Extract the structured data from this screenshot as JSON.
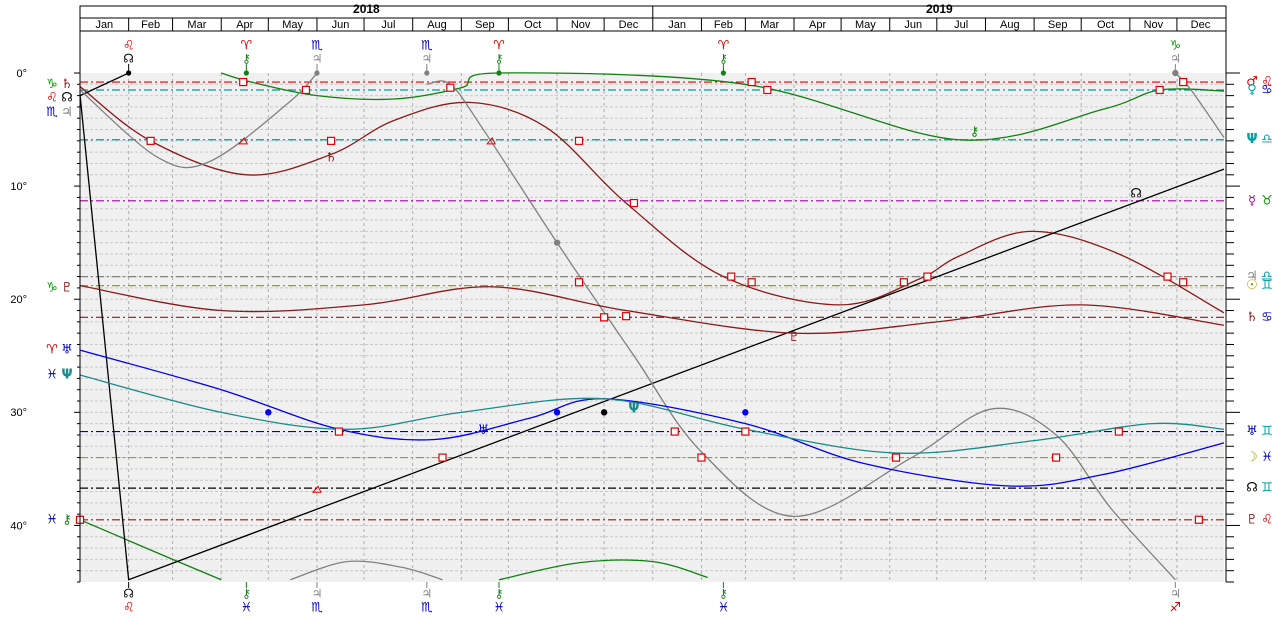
{
  "chart_data": {
    "type": "line",
    "years": [
      "2018",
      "2019"
    ],
    "months": [
      "Jan",
      "Feb",
      "Mar",
      "Apr",
      "May",
      "Jun",
      "Jul",
      "Aug",
      "Sep",
      "Oct",
      "Nov",
      "Dec"
    ],
    "x_domain": [
      "2018-01-01",
      "2019-12-31"
    ],
    "ylim": [
      0,
      45
    ],
    "y_ticks": [
      0,
      10,
      20,
      30,
      40
    ],
    "y_tick_suffix": "°",
    "grid": true,
    "colors": {
      "saturn": "#8b1a1a",
      "chiron": "#108010",
      "node": "#000000",
      "mercury": "#808080",
      "mars": "#e00000",
      "uranus": "#0000ee",
      "neptune": "#1a8a8a",
      "pluto": "#8b1a1a",
      "ref_red": "#e00000",
      "ref_cyan": "#00a0a0",
      "ref_purple": "#a000a0",
      "ref_olive": "#a0a000",
      "ref_brown": "#8b1a1a",
      "ref_blue": "#0000c0",
      "ref_black": "#000000",
      "sign_red": "#e00000",
      "sign_blue": "#0000c0",
      "sign_green": "#00a000"
    },
    "series": [
      {
        "key": "saturn",
        "color": "#8b1a1a",
        "x": [
          "2018-01-01",
          "2018-02-15",
          "2018-04-17",
          "2018-06-10",
          "2018-07-20",
          "2018-09-06",
          "2018-10-25",
          "2018-12-15",
          "2019-02-15",
          "2019-04-30",
          "2019-06-20",
          "2019-07-15",
          "2019-08-30",
          "2019-10-25",
          "2019-12-31"
        ],
        "y": [
          1.2,
          6.0,
          9.0,
          7.2,
          4.2,
          2.6,
          4.8,
          11.5,
          18.0,
          20.5,
          18.2,
          16.2,
          14.0,
          16.0,
          21.2
        ]
      },
      {
        "key": "chiron",
        "color": "#108010",
        "x": [
          "2018-04-01",
          "2018-04-20",
          "2018-06-01",
          "2018-07-20",
          "2018-09-01",
          "2018-09-25",
          "2019-03-01",
          "2019-07-15",
          "2019-10-15",
          "2019-11-20",
          "2019-12-31"
        ],
        "y": [
          0.0,
          0.8,
          2.0,
          2.3,
          1.3,
          0.0,
          1.0,
          5.9,
          3.2,
          1.5,
          1.6
        ]
      },
      {
        "key": "chiron_b",
        "color": "#108010",
        "x": [
          "2018-01-01",
          "2018-03-01",
          "2018-04-01"
        ],
        "y": [
          39.5,
          43.0,
          44.8
        ]
      },
      {
        "key": "chiron_c",
        "color": "#108010",
        "x": [
          "2018-09-25",
          "2018-11-15",
          "2019-01-01",
          "2019-02-05"
        ],
        "y": [
          44.8,
          43.3,
          43.2,
          44.6
        ]
      },
      {
        "key": "node",
        "color": "#000000",
        "x": [
          "2018-01-01",
          "2018-02-01",
          "2019-12-31"
        ],
        "y": [
          1.9,
          44.8,
          8.5
        ]
      },
      {
        "key": "node_b",
        "color": "#000000",
        "x": [
          "2018-01-01",
          "2018-02-01"
        ],
        "y": [
          2.0,
          0.0
        ]
      },
      {
        "key": "mercury",
        "color": "#808080",
        "x": [
          "2018-01-01",
          "2018-02-20",
          "2018-03-25",
          "2018-05-15",
          "2018-06-01"
        ],
        "y": [
          1.5,
          7.5,
          7.8,
          2.5,
          0.0
        ]
      },
      {
        "key": "mercury_b",
        "color": "#808080",
        "x": [
          "2018-08-10",
          "2018-08-25",
          "2018-09-15",
          "2018-11-01",
          "2018-12-20",
          "2019-02-01",
          "2019-04-01",
          "2019-06-15",
          "2019-08-05",
          "2019-09-15",
          "2019-10-20",
          "2019-11-30"
        ],
        "y": [
          1.0,
          1.0,
          5.0,
          15.0,
          25.0,
          33.5,
          39.2,
          34.0,
          29.7,
          32.0,
          38.5,
          44.8
        ]
      },
      {
        "key": "mercury_c",
        "color": "#808080",
        "x": [
          "2018-05-15",
          "2018-06-20",
          "2018-07-25",
          "2018-08-20"
        ],
        "y": [
          44.8,
          43.2,
          43.7,
          44.8
        ]
      },
      {
        "key": "mercury_d",
        "color": "#808080",
        "x": [
          "2019-11-30",
          "2019-12-10",
          "2019-12-31"
        ],
        "y": [
          0.0,
          1.5,
          5.7
        ]
      },
      {
        "key": "uranus",
        "color": "#0000ee",
        "x": [
          "2018-01-01",
          "2018-04-01",
          "2018-06-15",
          "2018-08-15",
          "2018-10-15",
          "2018-12-01",
          "2019-03-01",
          "2019-05-15",
          "2019-08-15",
          "2019-10-15",
          "2019-12-31"
        ],
        "y": [
          24.5,
          28.0,
          31.5,
          32.4,
          30.5,
          28.8,
          31.0,
          34.5,
          36.5,
          35.5,
          32.7
        ]
      },
      {
        "key": "neptune",
        "color": "#1a8a8a",
        "x": [
          "2018-01-01",
          "2018-04-01",
          "2018-06-20",
          "2018-09-01",
          "2018-12-01",
          "2019-03-01",
          "2019-06-05",
          "2019-09-01",
          "2019-11-15",
          "2019-12-31"
        ],
        "y": [
          26.7,
          30.0,
          31.5,
          30.0,
          28.8,
          31.5,
          33.6,
          32.5,
          31.0,
          31.5
        ]
      },
      {
        "key": "pluto",
        "color": "#8b1a1a",
        "x": [
          "2018-01-01",
          "2018-04-01",
          "2018-07-01",
          "2018-09-20",
          "2018-12-15",
          "2019-04-01",
          "2019-07-01",
          "2019-10-01",
          "2019-12-31"
        ],
        "y": [
          18.8,
          21.0,
          20.5,
          18.9,
          21.0,
          23.0,
          22.0,
          20.5,
          22.3
        ]
      }
    ],
    "markers": [
      {
        "series": "saturn",
        "x": "2018-02-15",
        "y": 6.0,
        "shape": "square",
        "color": "#e00000"
      },
      {
        "series": "saturn",
        "x": "2018-04-15",
        "y": 6.0,
        "shape": "triangle",
        "color": "#e00000"
      },
      {
        "series": "saturn",
        "x": "2018-06-10",
        "y": 6.0,
        "shape": "square",
        "color": "#e00000"
      },
      {
        "series": "saturn",
        "x": "2018-09-20",
        "y": 6.0,
        "shape": "triangle",
        "color": "#e00000"
      },
      {
        "series": "saturn",
        "x": "2018-11-15",
        "y": 6.0,
        "shape": "square",
        "color": "#e00000"
      },
      {
        "series": "saturn",
        "x": "2018-12-20",
        "y": 11.5,
        "shape": "square",
        "color": "#e00000"
      },
      {
        "series": "saturn",
        "x": "2019-02-20",
        "y": 18.0,
        "shape": "square",
        "color": "#e00000"
      },
      {
        "series": "saturn",
        "x": "2019-03-05",
        "y": 18.5,
        "shape": "square",
        "color": "#e00000"
      },
      {
        "series": "saturn",
        "x": "2019-06-10",
        "y": 18.5,
        "shape": "square",
        "color": "#e00000"
      },
      {
        "series": "saturn",
        "x": "2019-06-25",
        "y": 18.0,
        "shape": "square",
        "color": "#e00000"
      },
      {
        "series": "saturn",
        "x": "2019-11-25",
        "y": 18.0,
        "shape": "square",
        "color": "#e00000"
      },
      {
        "series": "saturn",
        "x": "2019-12-05",
        "y": 18.5,
        "shape": "square",
        "color": "#e00000"
      },
      {
        "series": "chiron",
        "x": "2018-04-15",
        "y": 0.8,
        "shape": "square",
        "color": "#e00000"
      },
      {
        "series": "chiron",
        "x": "2018-05-25",
        "y": 1.5,
        "shape": "square",
        "color": "#e00000"
      },
      {
        "series": "chiron",
        "x": "2018-08-25",
        "y": 1.3,
        "shape": "square",
        "color": "#e00000"
      },
      {
        "series": "chiron",
        "x": "2019-03-05",
        "y": 0.8,
        "shape": "square",
        "color": "#e00000"
      },
      {
        "series": "chiron",
        "x": "2019-03-15",
        "y": 1.5,
        "shape": "square",
        "color": "#e00000"
      },
      {
        "series": "chiron",
        "x": "2019-11-20",
        "y": 1.5,
        "shape": "square",
        "color": "#e00000"
      },
      {
        "series": "chiron",
        "x": "2019-12-05",
        "y": 0.8,
        "shape": "square",
        "color": "#e00000"
      },
      {
        "series": "node",
        "x": "2018-12-01",
        "y": 30.0,
        "shape": "dot",
        "color": "#000000"
      },
      {
        "series": "node",
        "x": "2018-08-20",
        "y": 34.0,
        "shape": "square",
        "color": "#e00000"
      },
      {
        "series": "node",
        "x": "2018-06-01",
        "y": 36.8,
        "shape": "triangle",
        "color": "#e00000"
      },
      {
        "series": "node",
        "x": "2018-01-01",
        "y": 39.5,
        "shape": "square",
        "color": "#e00000"
      },
      {
        "series": "mercury",
        "x": "2018-11-01",
        "y": 15.0,
        "shape": "dot",
        "color": "#808080"
      },
      {
        "series": "mercury",
        "x": "2018-11-15",
        "y": 18.5,
        "shape": "square",
        "color": "#e00000"
      },
      {
        "series": "mercury",
        "x": "2018-12-15",
        "y": 21.5,
        "shape": "square",
        "color": "#e00000"
      },
      {
        "series": "mercury",
        "x": "2019-01-15",
        "y": 31.7,
        "shape": "square",
        "color": "#e00000"
      },
      {
        "series": "mercury",
        "x": "2019-02-01",
        "y": 34.0,
        "shape": "square",
        "color": "#e00000"
      },
      {
        "series": "mercury",
        "x": "2019-11-30",
        "y": 0.0,
        "shape": "dot",
        "color": "#808080"
      },
      {
        "series": "uranus",
        "x": "2018-05-01",
        "y": 30.0,
        "shape": "dot",
        "color": "#0000ee"
      },
      {
        "series": "uranus",
        "x": "2018-11-01",
        "y": 30.0,
        "shape": "dot",
        "color": "#0000ee"
      },
      {
        "series": "uranus",
        "x": "2019-03-01",
        "y": 30.0,
        "shape": "dot",
        "color": "#0000ee"
      },
      {
        "series": "neptune",
        "x": "2018-06-15",
        "y": 31.7,
        "shape": "square",
        "color": "#e00000"
      },
      {
        "series": "neptune",
        "x": "2019-03-01",
        "y": 31.7,
        "shape": "square",
        "color": "#e00000"
      },
      {
        "series": "neptune",
        "x": "2019-06-05",
        "y": 34.0,
        "shape": "square",
        "color": "#e00000"
      },
      {
        "series": "neptune",
        "x": "2019-09-15",
        "y": 34.0,
        "shape": "square",
        "color": "#e00000"
      },
      {
        "series": "neptune",
        "x": "2019-10-25",
        "y": 31.7,
        "shape": "square",
        "color": "#e00000"
      },
      {
        "series": "pluto",
        "x": "2018-12-01",
        "y": 21.6,
        "shape": "square",
        "color": "#e00000"
      },
      {
        "series": "pluto",
        "x": "2019-12-15",
        "y": 39.5,
        "shape": "square",
        "color": "#e00000"
      }
    ],
    "ref_lines": [
      {
        "y": 0.8,
        "color": "#e00000",
        "glyphs": [
          {
            "t": "♂",
            "c": "#e00000"
          },
          {
            "t": "♌",
            "c": "#e00000"
          }
        ]
      },
      {
        "y": 1.5,
        "color": "#00a0a0",
        "glyphs": [
          {
            "t": "♀",
            "c": "#00a0a0"
          },
          {
            "t": "♋",
            "c": "#0000c0"
          }
        ]
      },
      {
        "y": 5.9,
        "color": "#00a0a0",
        "glyphs": [
          {
            "t": "Ψ",
            "c": "#00a0a0"
          },
          {
            "t": "♎",
            "c": "#00a0a0"
          }
        ]
      },
      {
        "y": 11.3,
        "color": "#a000a0",
        "glyphs": [
          {
            "t": "☿",
            "c": "#a000a0"
          },
          {
            "t": "♉",
            "c": "#00a000"
          }
        ]
      },
      {
        "y": 18.0,
        "color": "#808080",
        "glyphs": [
          {
            "t": "♃",
            "c": "#808080"
          },
          {
            "t": "♎",
            "c": "#00a0a0"
          }
        ]
      },
      {
        "y": 18.8,
        "color": "#a0a000",
        "glyphs": [
          {
            "t": "☉",
            "c": "#a0a000"
          },
          {
            "t": "♊",
            "c": "#00a0a0"
          }
        ]
      },
      {
        "y": 21.6,
        "color": "#8b1a1a",
        "glyphs": [
          {
            "t": "♄",
            "c": "#8b1a1a"
          },
          {
            "t": "♋",
            "c": "#0000c0"
          }
        ]
      },
      {
        "y": 31.7,
        "color": "#0000c0",
        "glyphs": [
          {
            "t": "♅",
            "c": "#0000c0"
          },
          {
            "t": "♊",
            "c": "#00a0a0"
          }
        ]
      },
      {
        "y": 34.0,
        "color": "#a0a000",
        "glyphs": [
          {
            "t": "☽",
            "c": "#a0a000"
          },
          {
            "t": "♓",
            "c": "#0000c0"
          }
        ]
      },
      {
        "y": 36.7,
        "color": "#000000",
        "glyphs": [
          {
            "t": "☊",
            "c": "#000000"
          },
          {
            "t": "♊",
            "c": "#00a0a0"
          }
        ]
      },
      {
        "y": 39.5,
        "color": "#8b1a1a",
        "glyphs": [
          {
            "t": "♇",
            "c": "#8b1a1a"
          },
          {
            "t": "♌",
            "c": "#e00000"
          }
        ]
      }
    ],
    "left_labels": [
      {
        "y": 1.0,
        "glyphs": [
          {
            "t": "♑",
            "c": "#00a000"
          },
          {
            "t": "♄",
            "c": "#8b1a1a"
          }
        ]
      },
      {
        "y": 2.2,
        "glyphs": [
          {
            "t": "♌",
            "c": "#e00000"
          },
          {
            "t": "☊",
            "c": "#000000"
          }
        ]
      },
      {
        "y": 3.5,
        "glyphs": [
          {
            "t": "♏",
            "c": "#0000c0"
          },
          {
            "t": "♃",
            "c": "#808080"
          }
        ]
      },
      {
        "y": 19.0,
        "glyphs": [
          {
            "t": "♑",
            "c": "#00a000"
          },
          {
            "t": "♇",
            "c": "#8b1a1a"
          }
        ]
      },
      {
        "y": 24.5,
        "glyphs": [
          {
            "t": "♈",
            "c": "#e00000"
          },
          {
            "t": "♅",
            "c": "#0000c0"
          }
        ]
      },
      {
        "y": 26.7,
        "glyphs": [
          {
            "t": "♓",
            "c": "#0000c0"
          },
          {
            "t": "Ψ",
            "c": "#1a8a8a"
          }
        ]
      },
      {
        "y": 39.5,
        "glyphs": [
          {
            "t": "♓",
            "c": "#0000c0"
          },
          {
            "t": "⚷",
            "c": "#108010"
          }
        ]
      }
    ],
    "top_events": [
      {
        "x": "2018-02-01",
        "sign": "♌",
        "sign_c": "#e00000",
        "planet": "☊",
        "planet_c": "#000000"
      },
      {
        "x": "2018-04-17",
        "sign": "♈",
        "sign_c": "#e00000",
        "planet": "⚷",
        "planet_c": "#108010"
      },
      {
        "x": "2018-06-01",
        "sign": "♏",
        "sign_c": "#0000c0",
        "planet": "♃",
        "planet_c": "#808080"
      },
      {
        "x": "2018-08-10",
        "sign": "♏",
        "sign_c": "#0000c0",
        "planet": "♃",
        "planet_c": "#808080"
      },
      {
        "x": "2018-09-25",
        "sign": "♈",
        "sign_c": "#e00000",
        "planet": "⚷",
        "planet_c": "#108010"
      },
      {
        "x": "2019-02-15",
        "sign": "♈",
        "sign_c": "#e00000",
        "planet": "⚷",
        "planet_c": "#108010"
      },
      {
        "x": "2019-11-30",
        "sign": "♑",
        "sign_c": "#00a000",
        "planet": "♃",
        "planet_c": "#808080"
      }
    ],
    "bottom_events": [
      {
        "x": "2018-02-01",
        "planet": "☊",
        "planet_c": "#000000",
        "sign": "♌",
        "sign_c": "#e00000"
      },
      {
        "x": "2018-04-17",
        "planet": "⚷",
        "planet_c": "#108010",
        "sign": "♓",
        "sign_c": "#0000c0"
      },
      {
        "x": "2018-06-01",
        "planet": "♃",
        "planet_c": "#808080",
        "sign": "♏",
        "sign_c": "#0000c0"
      },
      {
        "x": "2018-08-10",
        "planet": "♃",
        "planet_c": "#808080",
        "sign": "♏",
        "sign_c": "#0000c0"
      },
      {
        "x": "2018-09-25",
        "planet": "⚷",
        "planet_c": "#108010",
        "sign": "♓",
        "sign_c": "#0000c0"
      },
      {
        "x": "2019-02-15",
        "planet": "⚷",
        "planet_c": "#108010",
        "sign": "♓",
        "sign_c": "#0000c0"
      },
      {
        "x": "2019-11-30",
        "planet": "♃",
        "planet_c": "#808080",
        "sign": "♐",
        "sign_c": "#e00000"
      }
    ],
    "inline_labels": [
      {
        "x": "2018-06-10",
        "y": 7.5,
        "t": "♄",
        "c": "#8b1a1a"
      },
      {
        "x": "2019-07-25",
        "y": 5.2,
        "t": "⚷",
        "c": "#108010"
      },
      {
        "x": "2019-11-05",
        "y": 10.7,
        "t": "☊",
        "c": "#000000"
      },
      {
        "x": "2019-04-01",
        "y": 23.4,
        "t": "♇",
        "c": "#8b1a1a"
      },
      {
        "x": "2018-09-15",
        "y": 31.6,
        "t": "♅",
        "c": "#0000c0"
      },
      {
        "x": "2018-12-20",
        "y": 29.7,
        "t": "Ψ",
        "c": "#1a8a8a"
      }
    ]
  }
}
